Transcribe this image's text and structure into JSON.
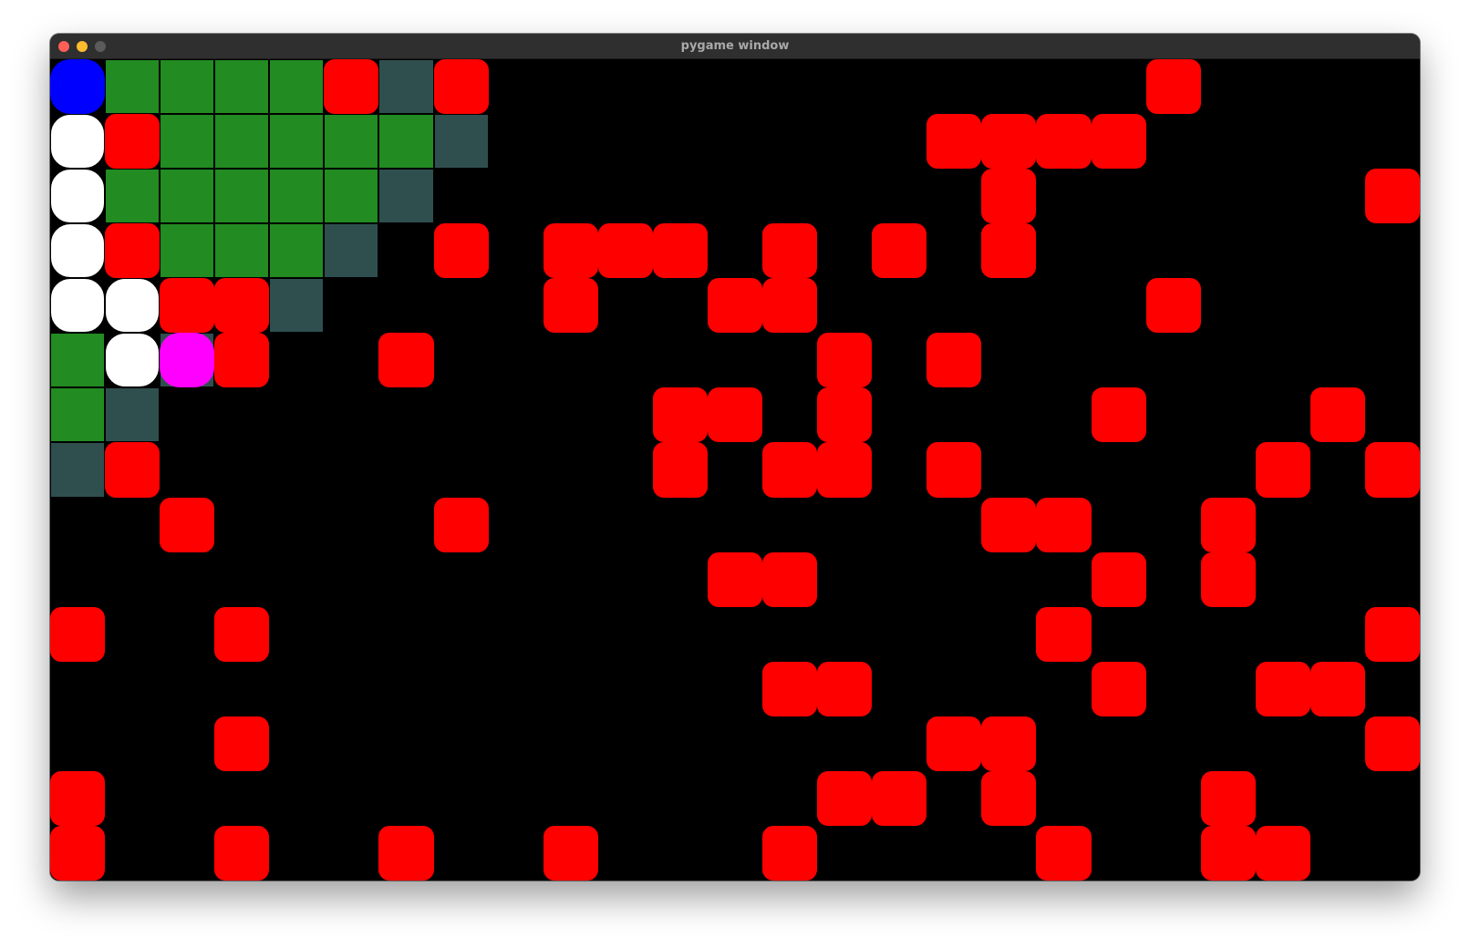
{
  "window": {
    "title": "pygame window"
  },
  "legend_colors": {
    "visited": "#228b22",
    "frontier": "#2f4f4f",
    "obstacle": "#ff0000",
    "path": "#ffffff",
    "start": "#0000ff",
    "agent": "#ff00ff",
    "background": "#000000"
  },
  "grid": {
    "cols": 25,
    "rows": 15,
    "start": [
      0,
      0
    ],
    "agent": [
      2,
      5
    ],
    "path": [
      [
        0,
        1
      ],
      [
        0,
        2
      ],
      [
        0,
        3
      ],
      [
        0,
        4
      ],
      [
        1,
        4
      ],
      [
        1,
        5
      ]
    ],
    "visited": [
      [
        1,
        0
      ],
      [
        2,
        0
      ],
      [
        3,
        0
      ],
      [
        4,
        0
      ],
      [
        2,
        1
      ],
      [
        3,
        1
      ],
      [
        4,
        1
      ],
      [
        5,
        1
      ],
      [
        6,
        1
      ],
      [
        1,
        2
      ],
      [
        2,
        2
      ],
      [
        3,
        2
      ],
      [
        4,
        2
      ],
      [
        5,
        2
      ],
      [
        2,
        3
      ],
      [
        3,
        3
      ],
      [
        4,
        3
      ],
      [
        0,
        5
      ],
      [
        0,
        6
      ]
    ],
    "frontier": [
      [
        6,
        0
      ],
      [
        7,
        1
      ],
      [
        6,
        2
      ],
      [
        5,
        3
      ],
      [
        4,
        4
      ],
      [
        2,
        5
      ],
      [
        1,
        6
      ],
      [
        0,
        7
      ]
    ],
    "obstacles": [
      [
        5,
        0
      ],
      [
        7,
        0
      ],
      [
        20,
        0
      ],
      [
        1,
        1
      ],
      [
        16,
        1
      ],
      [
        17,
        1
      ],
      [
        18,
        1
      ],
      [
        19,
        1
      ],
      [
        17,
        2
      ],
      [
        24,
        2
      ],
      [
        1,
        3
      ],
      [
        7,
        3
      ],
      [
        9,
        3
      ],
      [
        10,
        3
      ],
      [
        11,
        3
      ],
      [
        13,
        3
      ],
      [
        15,
        3
      ],
      [
        17,
        3
      ],
      [
        2,
        4
      ],
      [
        3,
        4
      ],
      [
        9,
        4
      ],
      [
        12,
        4
      ],
      [
        13,
        4
      ],
      [
        20,
        4
      ],
      [
        3,
        5
      ],
      [
        6,
        5
      ],
      [
        14,
        5
      ],
      [
        16,
        5
      ],
      [
        11,
        6
      ],
      [
        12,
        6
      ],
      [
        14,
        6
      ],
      [
        19,
        6
      ],
      [
        23,
        6
      ],
      [
        1,
        7
      ],
      [
        11,
        7
      ],
      [
        13,
        7
      ],
      [
        14,
        7
      ],
      [
        16,
        7
      ],
      [
        22,
        7
      ],
      [
        24,
        7
      ],
      [
        2,
        8
      ],
      [
        7,
        8
      ],
      [
        17,
        8
      ],
      [
        18,
        8
      ],
      [
        21,
        8
      ],
      [
        12,
        9
      ],
      [
        13,
        9
      ],
      [
        19,
        9
      ],
      [
        21,
        9
      ],
      [
        0,
        10
      ],
      [
        3,
        10
      ],
      [
        18,
        10
      ],
      [
        24,
        10
      ],
      [
        13,
        11
      ],
      [
        14,
        11
      ],
      [
        19,
        11
      ],
      [
        22,
        11
      ],
      [
        23,
        11
      ],
      [
        3,
        12
      ],
      [
        16,
        12
      ],
      [
        17,
        12
      ],
      [
        24,
        12
      ],
      [
        0,
        13
      ],
      [
        14,
        13
      ],
      [
        15,
        13
      ],
      [
        17,
        13
      ],
      [
        21,
        13
      ],
      [
        0,
        14
      ],
      [
        3,
        14
      ],
      [
        6,
        14
      ],
      [
        9,
        14
      ],
      [
        13,
        14
      ],
      [
        18,
        14
      ],
      [
        21,
        14
      ],
      [
        22,
        14
      ]
    ]
  }
}
